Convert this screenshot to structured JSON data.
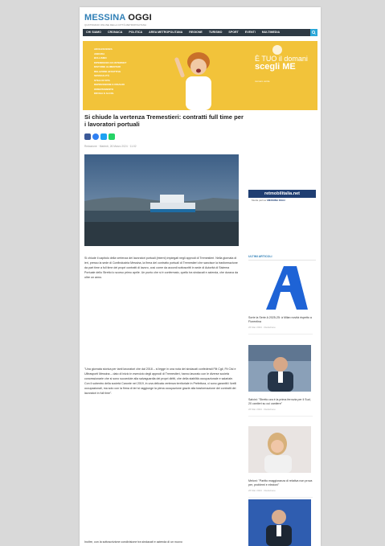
{
  "header": {
    "logo_part1": "MESSINA",
    "logo_part2": "OGGI",
    "tagline": "QUOTIDIANO ONLINE DELLA CITTÀ METROPOLITANA"
  },
  "nav": {
    "items": [
      "CHI SIAMO",
      "CRONACA",
      "POLITICA",
      "AREA METROPOLITANA",
      "REGIONE",
      "TURISMO",
      "SPORT",
      "EVENTI",
      "MULTIMEDIA"
    ]
  },
  "banner": {
    "list": [
      "ADOLESCENZA",
      "AMICIZIA",
      "BULLISMO",
      "DIPENDENZA DA INTERNET",
      "DISTURBI ALIMENTARI",
      "RELAZIONI AFFETTIVE",
      "SESSUALITÀ",
      "STILE DI VITA",
      "DEPRESSIONE E DISAGIO",
      "ORIENTAMENTO",
      "DROGA E ALCOL"
    ],
    "slogan_line1": "È TUO il domani",
    "slogan_line2": "scegli ME",
    "slogan_small": "numero verde"
  },
  "article": {
    "title": "Si chiude la vertenza Tremestieri: contratti full time per i lavoratori portuali",
    "meta": "Redazione · Martedì, 26 Marzo 2024 · 11:02",
    "para1": "Si chiude il capitolo della vertenza dei lavoratori portuali (interni) impiegati negli approdi di Tremestieri. Nella giornata di ieri, presso la sede di Confindustria Messina, la firma del contratto portuali di Tremestieri che sancisce la trasformazione da part time a full time dei propri contratti di lavoro, così come da accordi sottoscritti in sede di Autorità di Sistema Portuale dello Stretto lo scorso primo aprile. Un punto che si è confermato, quello tra sindacati e azienda, che durava da oltre un anno.",
    "para2": "\"Una giornata storica per tanti lavoratori che dal 2018 – si legge in una nota dei sindacati confederali Filt Cgil, Fit Cisl e Uiltrasporti Messina – dato di inizio in esercizio degli approdi di Tremestieri, hanno lavorato con le diverse società concessionarie che si sono succedute alla salvaguardia dei propri diritti, che della stabilità occupazionale e salariale. Con il subentro della società Caronte nel 2019, in una delicata vertenza territoriale in Prefettura, ci sono garantiti i livelli occupazionali, ma solo con la firma di ieri si raggiunge la piena occupazione grazie alla trasformazione dei contratti dei lavoratori in full time\".",
    "para3": "Inoltre, con la sottoscrizione condivisione tra sindacati e azienda di un nuovo"
  },
  "sidebar": {
    "ad_label": "retmobilitalia.net",
    "ad_sub_prefix": "Media partner",
    "ad_sub_brand": "MESSINA OGGI",
    "heading": "ULTIMI ARTICOLI",
    "posts": [
      {
        "title": "Sorte la Serie A 2025-25: à Milan novità rispetto a Fiorentina",
        "date": "26 Mar 2024 · Redazione"
      },
      {
        "title": "Salvini: \"Stretto ora è la prima ferrovia per il Sud, 20 cantieri su cui cantiere\"",
        "date": "26 Mar 2024 · Redazione"
      },
      {
        "title": "Meloni: \"Partito maggioranza di relativa non prova per, problemi e elezioni\"",
        "date": "26 Mar 2024 · Redazione"
      }
    ]
  },
  "colors": {
    "nav_bg": "#2e3a44",
    "accent_blue": "#2f7fb6",
    "banner_yellow": "#f2c33a",
    "facebook": "#3b5998",
    "messenger": "#2f7ff2",
    "twitter": "#1da1f2",
    "whatsapp": "#25d366"
  }
}
